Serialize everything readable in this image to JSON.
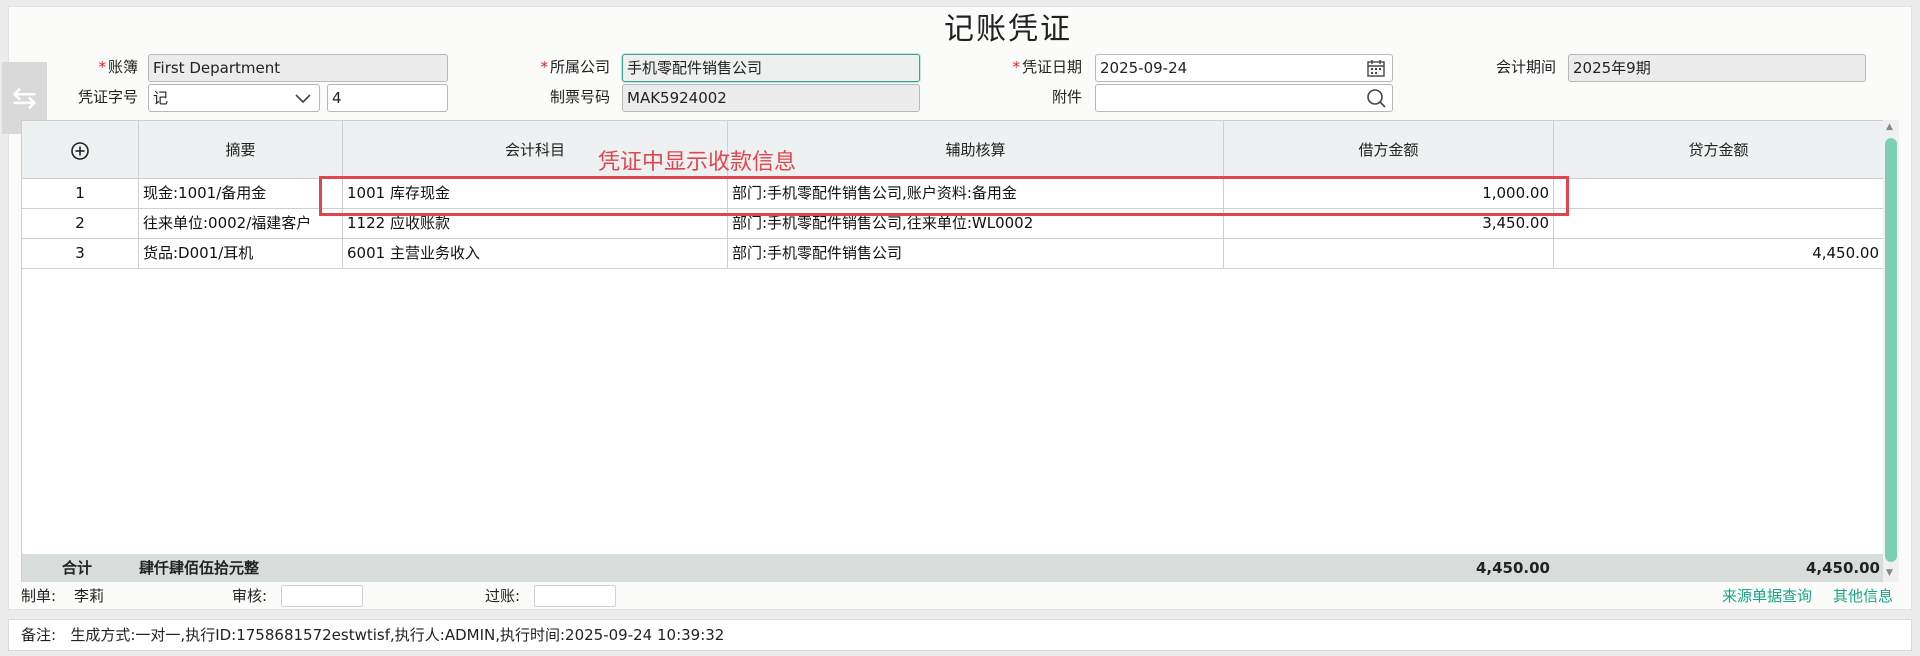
{
  "title": "记账凭证",
  "header": {
    "ledger": {
      "label": "账簿",
      "required": "*",
      "value": "First Department"
    },
    "company": {
      "label": "所属公司",
      "required": "*",
      "value": "手机零配件销售公司"
    },
    "voucher_date": {
      "label": "凭证日期",
      "required": "*",
      "value": "2025-09-24"
    },
    "period": {
      "label": "会计期间",
      "value": "2025年9期"
    },
    "voucher_word": {
      "label": "凭证字号",
      "value": "记",
      "number": "4"
    },
    "maker_code": {
      "label": "制票号码",
      "value": "MAK5924002"
    },
    "attachment": {
      "label": "附件",
      "value": ""
    }
  },
  "grid": {
    "columns": [
      "摘要",
      "会计科目",
      "辅助核算",
      "借方金额",
      "贷方金额"
    ],
    "rows": [
      {
        "no": "1",
        "summary": "现金:1001/备用金",
        "account": "1001 库存现金",
        "aux": "部门:手机零配件销售公司,账户资料:备用金",
        "debit": "1,000.00",
        "credit": ""
      },
      {
        "no": "2",
        "summary": "往来单位:0002/福建客户",
        "account": "1122 应收账款",
        "aux": "部门:手机零配件销售公司,往来单位:WL0002",
        "debit": "3,450.00",
        "credit": ""
      },
      {
        "no": "3",
        "summary": "货品:D001/耳机",
        "account": "6001 主营业务收入",
        "aux": "部门:手机零配件销售公司",
        "debit": "",
        "credit": "4,450.00"
      }
    ],
    "total": {
      "label": "合计",
      "amount_words": "肆仟肆佰伍拾元整",
      "debit": "4,450.00",
      "credit": "4,450.00"
    }
  },
  "annotation": "凭证中显示收款信息",
  "footer": {
    "maker_label": "制单:",
    "maker_value": "李莉",
    "review_label": "审核:",
    "post_label": "过账:",
    "link_source": "来源单据查询",
    "link_other": "其他信息"
  },
  "remark": {
    "label": "备注:",
    "text": "生成方式:一对一,执行ID:1758681572estwtisf,执行人:ADMIN,执行时间:2025-09-24 10:39:32"
  },
  "colors": {
    "accent": "#19a58a",
    "annotation": "#e0464e",
    "scroll": "#7ccfb5"
  }
}
